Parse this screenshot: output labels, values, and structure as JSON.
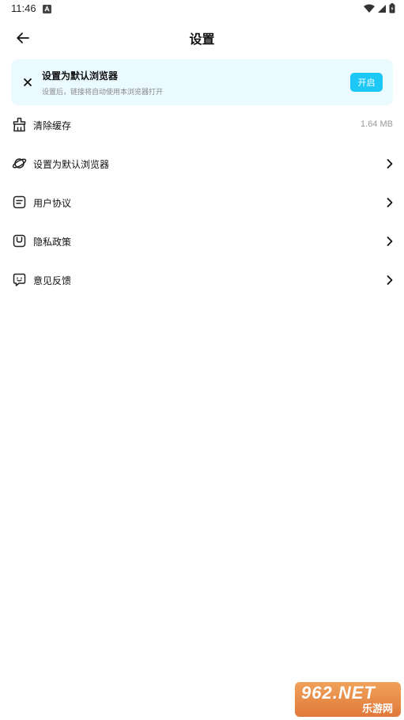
{
  "status_bar": {
    "time": "11:46"
  },
  "header": {
    "title": "设置"
  },
  "banner": {
    "title": "设置为默认浏览器",
    "subtitle": "设置后，链接将自动使用本浏览器打开",
    "button_label": "开启"
  },
  "settings": {
    "items": [
      {
        "label": "清除缓存",
        "value": "1.64 MB",
        "icon": "broom-icon"
      },
      {
        "label": "设置为默认浏览器",
        "icon": "planet-icon"
      },
      {
        "label": "用户协议",
        "icon": "document-icon"
      },
      {
        "label": "隐私政策",
        "icon": "privacy-icon"
      },
      {
        "label": "意见反馈",
        "icon": "feedback-icon"
      }
    ]
  },
  "watermark": {
    "top": "962.NET",
    "bottom": "乐游网"
  },
  "colors": {
    "accent": "#1ec8f6",
    "banner_bg": "#eafaff",
    "text_primary": "#111111",
    "text_secondary": "#8a8a8a"
  }
}
